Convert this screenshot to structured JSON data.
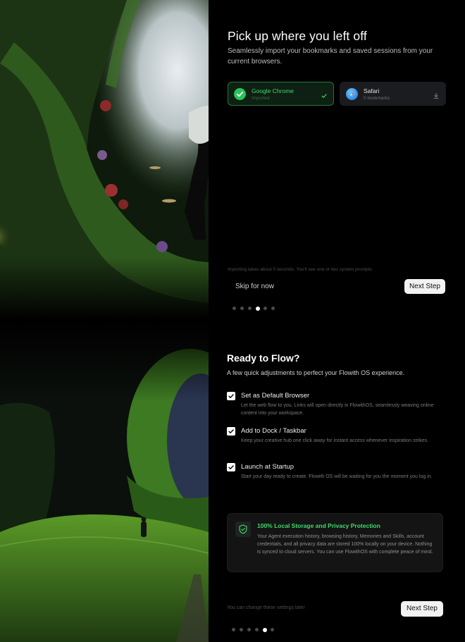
{
  "import_step": {
    "title": "Pick up where you left off",
    "subtitle": "Seamlessly import your bookmarks and saved sessions from your current browsers.",
    "browsers": [
      {
        "name": "Google Chrome",
        "status": "Imported",
        "icon": "chrome-check-icon",
        "trail_icon": "check-icon"
      },
      {
        "name": "Safari",
        "status": "0 bookmarks",
        "icon": "safari-compass-icon",
        "trail_icon": "download-icon"
      }
    ],
    "note": "Importing takes about 5 seconds. You'll see one or two system prompts.",
    "skip_label": "Skip for now",
    "next_label": "Next Step",
    "progress": {
      "total": 6,
      "current": 4
    }
  },
  "ready_step": {
    "title": "Ready to Flow?",
    "subtitle": "A few quick adjustments to perfect your Flowith OS experience.",
    "options": [
      {
        "title": "Set as Default Browser",
        "description": "Let the web flow to you. Links will open directly in FlowithOS, seamlessly weaving online content into your workspace.",
        "checked": true
      },
      {
        "title": "Add to Dock / Taskbar",
        "description": "Keep your creative hub one click away for instant access whenever inspiration strikes.",
        "checked": true
      },
      {
        "title": "Launch at Startup",
        "description": "Start your day ready to create. Flowith OS will be waiting for you the moment you log in.",
        "checked": true
      }
    ],
    "privacy": {
      "icon": "shield-check-icon",
      "title": "100% Local Storage and Privacy Protection",
      "body": "Your Agent execution history, browsing history, Memories and Skills, account credentials, and all privacy data are stored 100% locally on your device. Nothing is synced to cloud servers. You can use FlowithOS with complete peace of mind."
    },
    "note": "You can change these settings later",
    "next_label": "Next Step",
    "progress": {
      "total": 6,
      "current": 5
    }
  },
  "colors": {
    "accent_green": "#3ddc6a",
    "background": "#000000",
    "button_bg": "#f2f2f2"
  }
}
